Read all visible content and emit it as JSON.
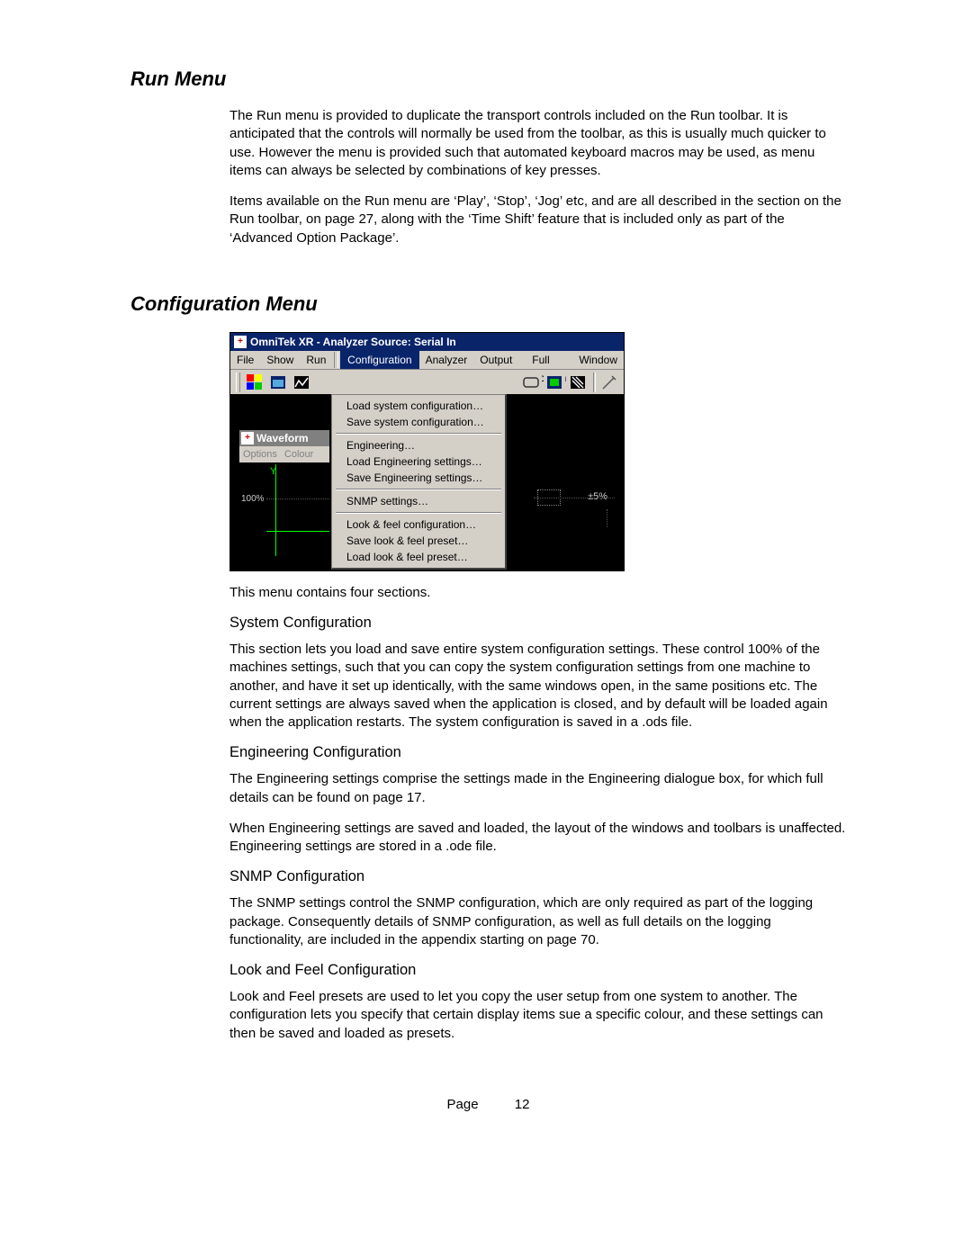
{
  "headings": {
    "run_menu": "Run Menu",
    "config_menu": "Configuration Menu",
    "sys_conf": "System Configuration",
    "eng_conf": "Engineering Configuration",
    "snmp_conf": "SNMP Configuration",
    "look_conf": "Look and Feel Configuration"
  },
  "paras": {
    "run1": "The Run menu is provided to duplicate the transport controls included on the Run toolbar. It is anticipated that the controls will normally be used from the toolbar, as this is usually much quicker to use.  However the menu is provided such that automated keyboard macros may be used, as menu items can always be selected by combinations of key presses.",
    "run2": "Items available on the Run menu are ‘Play’, ‘Stop’, ‘Jog’ etc, and are all described in the section on the Run toolbar, on page 27, along with the ‘Time Shift’ feature that is included only as part of the ‘Advanced Option Package’.",
    "menu_intro": "This menu contains four sections.",
    "sys_body": "This section lets you load and save entire system configuration settings.  These control 100% of the machines settings, such that you can copy the system configuration settings from one machine to another, and have it set up identically, with the same windows open, in the same positions etc.  The current settings are always saved when the application is closed, and by default will be loaded again when the application restarts.  The system configuration is saved in a .ods file.",
    "eng_body1": "The Engineering settings comprise the settings made in the Engineering dialogue box, for which full details can be found on page 17.",
    "eng_body2": "When Engineering settings are saved and loaded, the layout of the windows and toolbars is unaffected.  Engineering settings are stored in a .ode file.",
    "snmp_body": "The SNMP settings control the SNMP configuration, which are only required as part of the logging package.  Consequently details of SNMP configuration, as well as full details on the logging functionality, are included in the appendix starting on page 70.",
    "look_body": "Look and Feel presets are used to let you copy the user setup from one system to another.  The configuration lets you specify that certain display items sue a specific colour, and these settings can then be saved and loaded as presets."
  },
  "footer": {
    "label": "Page",
    "number": "12"
  },
  "screenshot": {
    "title": "OmniTek XR - Analyzer Source: Serial In",
    "menubar": {
      "file": "File",
      "show": "Show",
      "run": "Run",
      "configuration": "Configuration",
      "analyzer": "Analyzer",
      "output": "Output",
      "fullscreen": "Full Screen",
      "window": "Window"
    },
    "dropdown": {
      "load_sys": "Load system configuration…",
      "save_sys": "Save system configuration…",
      "engineering": "Engineering…",
      "load_eng": "Load Engineering settings…",
      "save_eng": "Save Engineering settings…",
      "snmp": "SNMP settings…",
      "look_conf": "Look & feel configuration…",
      "save_look": "Save look & feel preset…",
      "load_look": "Load look & feel preset…"
    },
    "waveform": {
      "title": "Waveform",
      "options": "Options",
      "colour": "Colour",
      "y": "Y",
      "pct100": "100%"
    },
    "right_label": "±5%"
  }
}
